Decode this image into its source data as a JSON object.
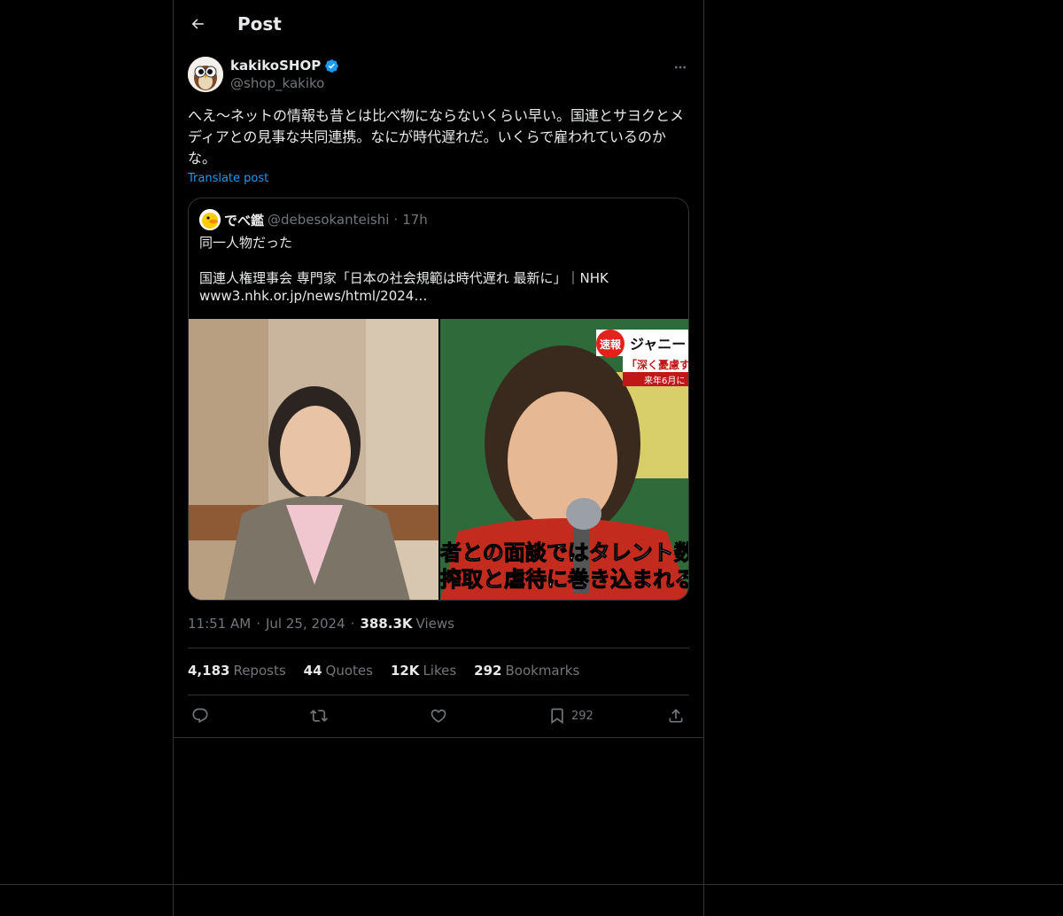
{
  "header": {
    "title": "Post"
  },
  "post": {
    "author_name": "kakikoSHOP",
    "author_handle": "@shop_kakiko",
    "text": "へえ〜ネットの情報も昔とは比べ物にならないくらい早い。国連とサヨクとメディアとの見事な共同連携。なにが時代遅れだ。いくらで雇われているのかな。",
    "translate_label": "Translate post",
    "time": "11:51 AM",
    "date": "Jul 25, 2024",
    "views_count": "388.3K",
    "views_label": "Views"
  },
  "quote": {
    "name": "でべ鑑",
    "handle": "@debesokanteishi",
    "dot": "·",
    "time": "17h",
    "text": "同一人物だった\n\n国連人権理事会 専門家「日本の社会規範は時代遅れ 最新に」｜NHK\nwww3.nhk.or.jp/news/html/2024…",
    "image_right_badge": "速報",
    "image_right_headline": "ジャニー",
    "image_right_sub": "「深く憂慮す",
    "image_right_sub2": "来年6月に",
    "image_right_caption1": "者との面談ではタレント数百",
    "image_right_caption2": "搾取と虐待に巻き込まれると"
  },
  "stats": {
    "reposts_count": "4,183",
    "reposts_label": "Reposts",
    "quotes_count": "44",
    "quotes_label": "Quotes",
    "likes_count": "12K",
    "likes_label": "Likes",
    "bookmarks_count": "292",
    "bookmarks_label": "Bookmarks"
  },
  "actions": {
    "bookmark_count": "292"
  },
  "icons": [
    "back-arrow-icon",
    "verified-badge-icon",
    "more-icon",
    "reply-icon",
    "repost-icon",
    "like-icon",
    "bookmark-icon",
    "share-icon"
  ],
  "colors": {
    "background": "#000000",
    "accent": "#1d9bf0",
    "text": "#e7e9ea",
    "muted": "#71767b",
    "border": "#2f3336"
  }
}
